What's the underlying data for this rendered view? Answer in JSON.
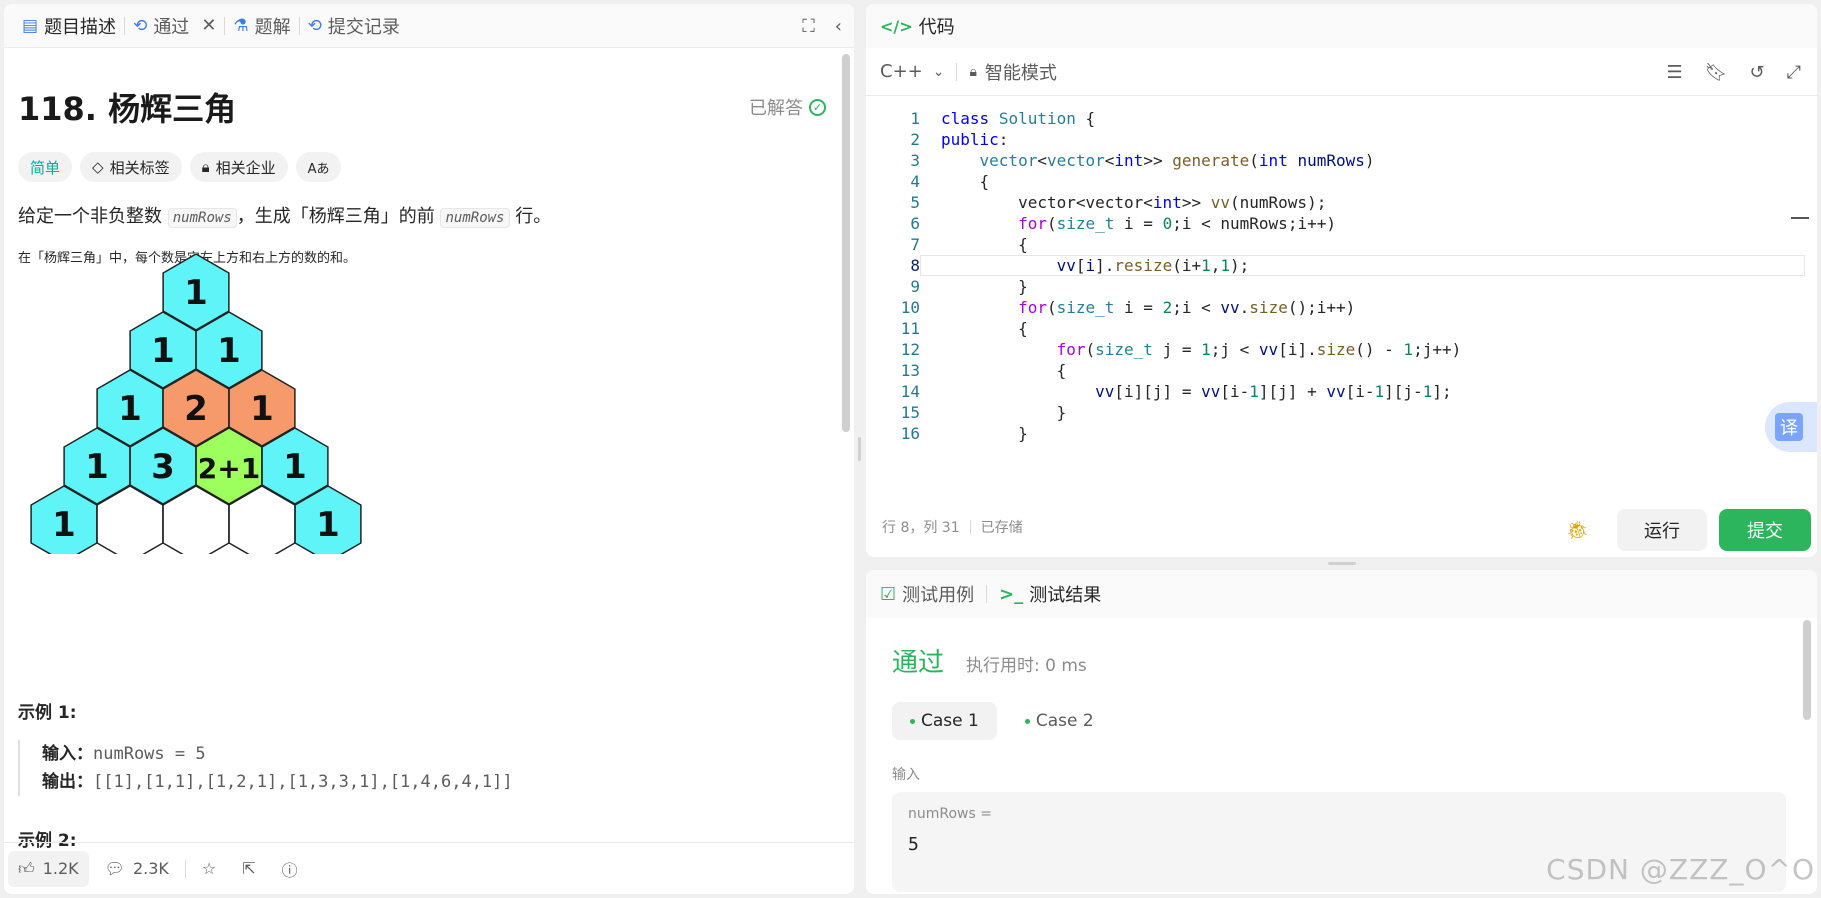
{
  "left_tabs": [
    {
      "label": "题目描述",
      "icon": "description-icon"
    },
    {
      "label": "通过",
      "icon": "history-icon"
    },
    {
      "label": "题解",
      "icon": "flask-icon"
    },
    {
      "label": "提交记录",
      "icon": "history-icon"
    }
  ],
  "problem": {
    "title": "118. 杨辉三角",
    "status": "已解答",
    "tags": {
      "difficulty": "简单",
      "related_tags": "相关标签",
      "related_companies": "相关企业",
      "font_toggle": "Aあ"
    },
    "desc_part1": "给定一个非负整数 ",
    "desc_code": "numRows",
    "desc_part2": "，生成「杨辉三角」的前 ",
    "desc_code2": "numRows",
    "desc_part3": " 行。",
    "note": "在「杨辉三角」中，每个数是它左上方和右上方的数的和。",
    "figure": {
      "rows": [
        [
          "1"
        ],
        [
          "1",
          "1"
        ],
        [
          "1",
          "2",
          "1"
        ],
        [
          "1",
          "3",
          "2+1",
          "1"
        ],
        [
          "1",
          "",
          "",
          "",
          "1"
        ]
      ],
      "colors": {
        "cyan": "#5ff4f7",
        "orange": "#f79a6b",
        "green": "#9dff5e",
        "white": "#ffffff"
      }
    },
    "example1_title": "示例 1:",
    "example1_input_label": "输入：",
    "example1_input": "numRows = 5",
    "example1_output_label": "输出：",
    "example1_output": "[[1],[1,1],[1,2,1],[1,3,3,1],[1,4,6,4,1]]",
    "example2_title": "示例 2:"
  },
  "left_footer": {
    "likes": "1.2K",
    "comments": "2.3K"
  },
  "editor": {
    "tab_label": "代码",
    "language": "C++",
    "mode": "智能模式",
    "status_line": "行 8，列 31",
    "saved": "已存储",
    "run_label": "运行",
    "submit_label": "提交",
    "translate_label": "译"
  },
  "tests": {
    "tab_testcase": "测试用例",
    "tab_result": "测试结果",
    "result": "通过",
    "runtime": "执行用时: 0 ms",
    "cases": [
      "Case 1",
      "Case 2"
    ],
    "input_label": "输入",
    "var_name": "numRows =",
    "var_value": "5"
  },
  "watermark": "CSDN @ZZZ_O^O"
}
